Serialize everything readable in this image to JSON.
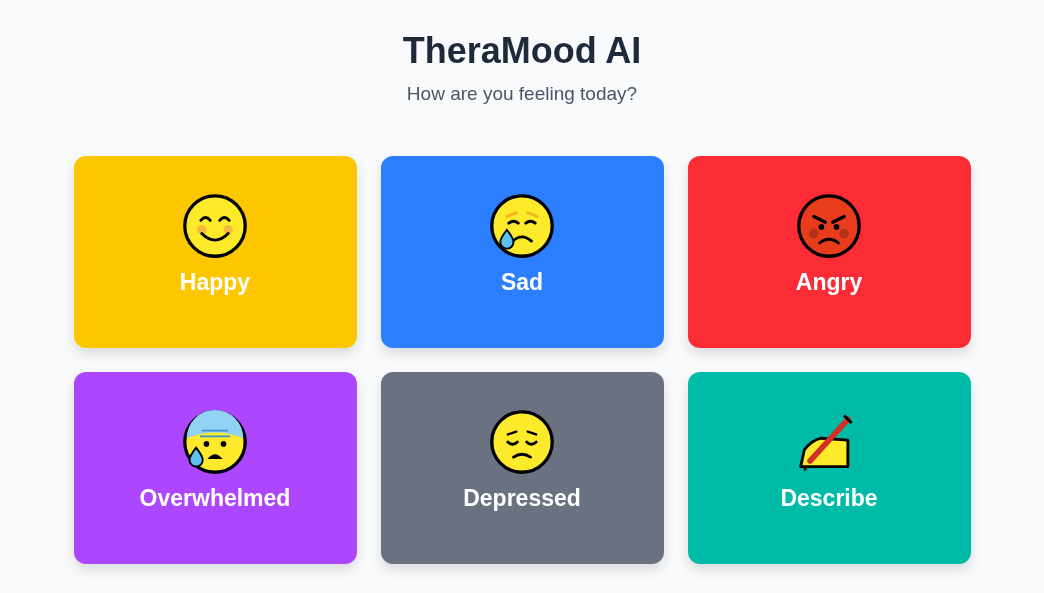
{
  "header": {
    "title": "TheraMood AI",
    "subtitle": "How are you feeling today?"
  },
  "moods": [
    {
      "label": "Happy",
      "kind": "happy",
      "color": "#fdc700"
    },
    {
      "label": "Sad",
      "kind": "sad",
      "color": "#2b7fff"
    },
    {
      "label": "Angry",
      "kind": "angry",
      "color": "#fb2c36"
    },
    {
      "label": "Overwhelmed",
      "kind": "overwhelmed",
      "color": "#ad46ff"
    },
    {
      "label": "Depressed",
      "kind": "depressed",
      "color": "#6a7282"
    },
    {
      "label": "Describe",
      "kind": "describe",
      "color": "#00bba7"
    }
  ]
}
